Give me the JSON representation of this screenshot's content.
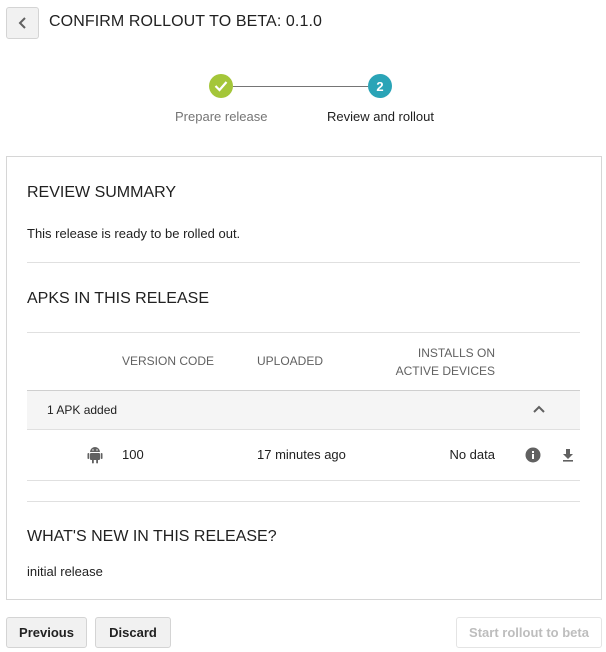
{
  "header": {
    "title": "CONFIRM ROLLOUT TO BETA: 0.1.0",
    "back_icon": "chevron-left-icon"
  },
  "stepper": {
    "steps": [
      {
        "label": "Prepare release",
        "state": "completed",
        "indicator_icon": "check-icon"
      },
      {
        "label": "Review and rollout",
        "state": "active",
        "number": "2"
      }
    ],
    "colors": {
      "completed": "#a4c639",
      "active": "#2aa4b7"
    }
  },
  "review": {
    "title": "REVIEW SUMMARY",
    "message": "This release is ready to be rolled out."
  },
  "apks": {
    "title": "APKS IN THIS RELEASE",
    "columns": {
      "version_code": "VERSION CODE",
      "uploaded": "UPLOADED",
      "installs_line1": "INSTALLS ON",
      "installs_line2": "ACTIVE DEVICES"
    },
    "group_label": "1 APK added",
    "rows": [
      {
        "platform_icon": "android-icon",
        "version_code": "100",
        "uploaded": "17 minutes ago",
        "installs": "No data"
      }
    ]
  },
  "whats_new": {
    "title": "WHAT'S NEW IN THIS RELEASE?",
    "text": "initial release"
  },
  "footer": {
    "previous_label": "Previous",
    "discard_label": "Discard",
    "rollout_label": "Start rollout to beta"
  }
}
